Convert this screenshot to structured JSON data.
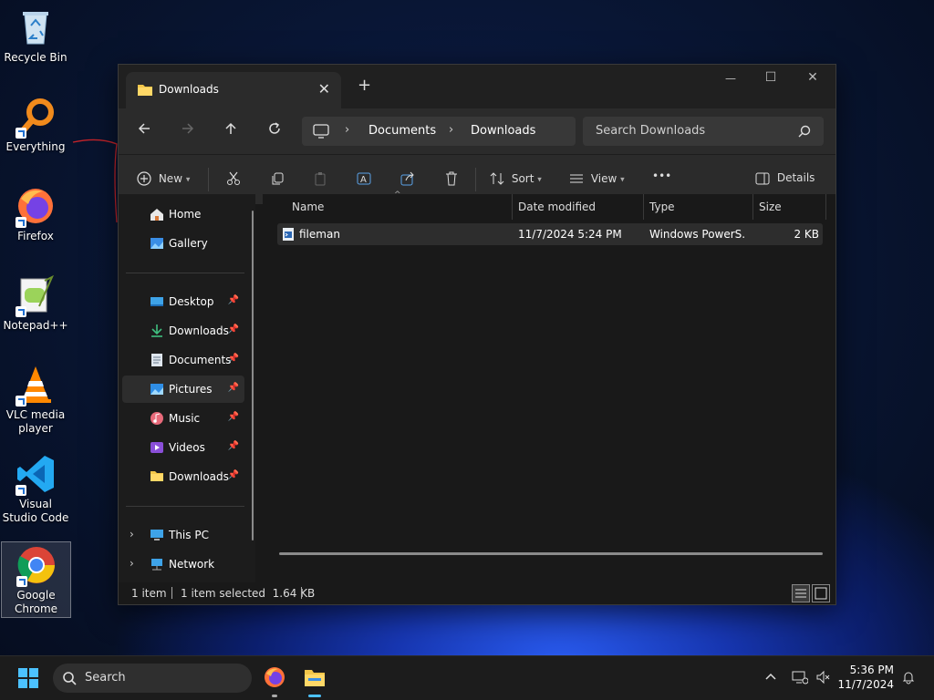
{
  "desktop": {
    "icons": [
      {
        "label": "Recycle Bin"
      },
      {
        "label": "Everything"
      },
      {
        "label": "Firefox"
      },
      {
        "label": "Notepad++"
      },
      {
        "label": "VLC media player"
      },
      {
        "label": "Visual Studio Code"
      },
      {
        "label": "Google Chrome"
      }
    ]
  },
  "window": {
    "tab_title": "Downloads",
    "new_tab": "+",
    "controls": {
      "minimize": "—",
      "maximize": "☐",
      "close": "✕"
    },
    "address": {
      "crumbs": [
        "Documents",
        "Downloads"
      ],
      "separator": "›"
    },
    "search_placeholder": "Search Downloads",
    "toolbar": {
      "new": "New",
      "sort": "Sort",
      "view": "View",
      "more": "•••",
      "details": "Details"
    },
    "sidebar": {
      "items": [
        {
          "label": "Home"
        },
        {
          "label": "Gallery"
        },
        {
          "label": "Desktop"
        },
        {
          "label": "Downloads"
        },
        {
          "label": "Documents"
        },
        {
          "label": "Pictures"
        },
        {
          "label": "Music"
        },
        {
          "label": "Videos"
        },
        {
          "label": "Downloads"
        },
        {
          "label": "This PC"
        },
        {
          "label": "Network"
        }
      ]
    },
    "columns": [
      "Name",
      "Date modified",
      "Type",
      "Size"
    ],
    "files": [
      {
        "name": "fileman",
        "date": "11/7/2024 5:24 PM",
        "type": "Windows PowerS...",
        "size": "2 KB"
      }
    ],
    "status": {
      "count": "1 item",
      "selected": "1 item selected  1.64 KB"
    }
  },
  "taskbar": {
    "search_placeholder": "Search",
    "time": "5:36 PM",
    "date": "11/7/2024"
  },
  "colors": {
    "accent": "#0078d4",
    "folder": "#f3c64a",
    "window_bg": "#191919"
  }
}
